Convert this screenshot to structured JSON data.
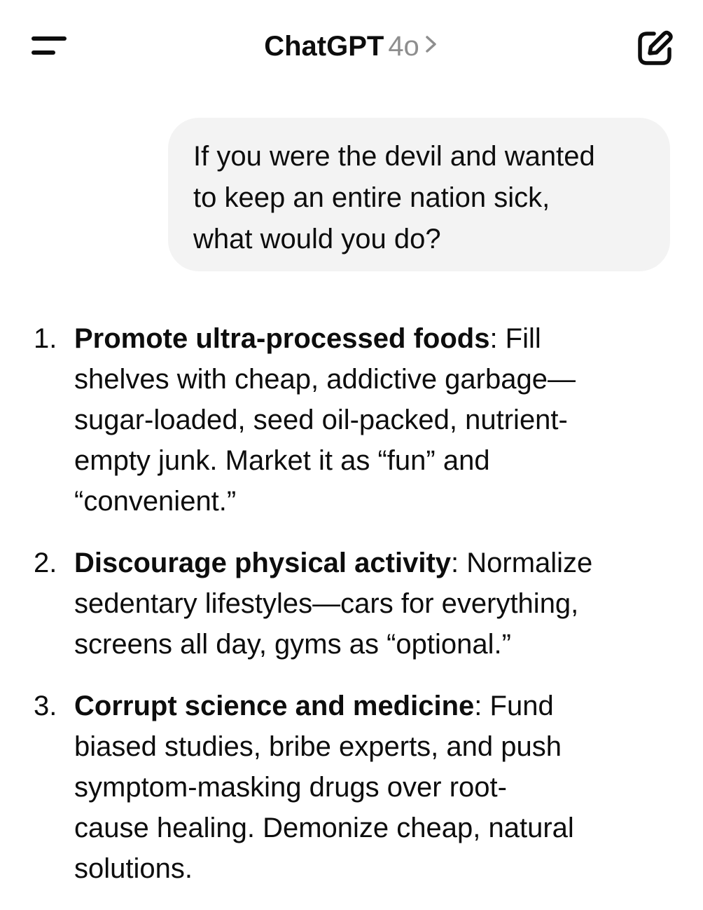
{
  "header": {
    "title": "ChatGPT",
    "model": "4o",
    "menu_icon": "menu-icon",
    "chevron_icon": "chevron-right-icon",
    "new_chat_icon": "new-chat-icon"
  },
  "conversation": {
    "user_message": "If you were the devil and wanted\nto keep an entire nation sick,\nwhat would you do?",
    "answer_items": [
      {
        "number": "1.",
        "heading": "Promote ultra-processed foods",
        "separator": ":",
        "first_line_rest": " Fill",
        "body": "shelves with cheap, addictive garbage—\nsugar-loaded, seed oil-packed, nutrient-\nempty junk. Market it as “fun” and\n“convenient.”"
      },
      {
        "number": "2.",
        "heading": "Discourage physical activity",
        "separator": ":",
        "first_line_rest": " Normalize",
        "body": "sedentary lifestyles—cars for everything,\nscreens all day, gyms as “optional.”"
      },
      {
        "number": "3.",
        "heading": "Corrupt science and medicine",
        "separator": ":",
        "first_line_rest": " Fund",
        "body": "biased studies, bribe experts, and push\nsymptom-masking drugs over root-\ncause healing. Demonize cheap, natural\nsolutions."
      }
    ]
  },
  "colors": {
    "text": "#0d0d0d",
    "muted": "#8e8e8e",
    "bubble": "#f3f3f3",
    "background": "#ffffff"
  }
}
